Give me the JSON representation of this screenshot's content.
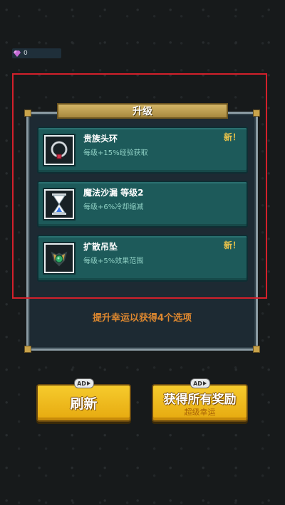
{
  "currency": {
    "gem_count": "0"
  },
  "panel": {
    "title": "升级",
    "hint": "提升幸运以获得4个选项"
  },
  "upgrades": [
    {
      "name": "贵族头环",
      "desc": "每级+15%经验获取",
      "badge": "新！",
      "icon": "ring-icon"
    },
    {
      "name": "魔法沙漏 等级2",
      "desc": "每级+6%冷却缩减",
      "badge": "",
      "icon": "hourglass-icon"
    },
    {
      "name": "扩散吊坠",
      "desc": "每级+5%效果范围",
      "badge": "新！",
      "icon": "pendant-icon"
    }
  ],
  "buttons": {
    "refresh_label": "刷新",
    "get_all_label": "获得所有奖励",
    "get_all_sub": "超级幸运",
    "ad_tag": "AD"
  },
  "colors": {
    "accent_gold": "#f6cb2d",
    "card_teal": "#1d5a5a",
    "highlight_red": "#d3202b",
    "hint_orange": "#e0892f"
  }
}
